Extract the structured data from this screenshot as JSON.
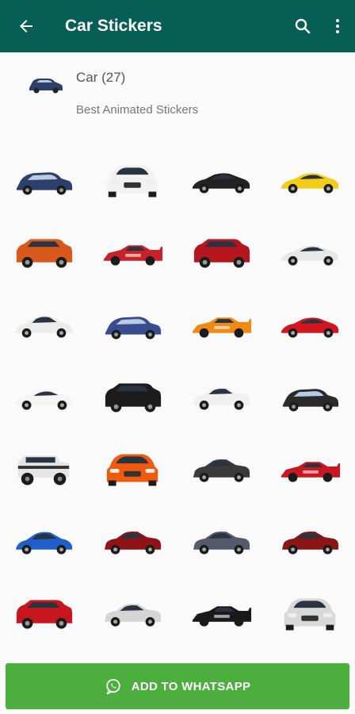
{
  "appbar": {
    "title": "Car Stickers",
    "color": "#075e54",
    "icons": [
      "back-arrow-icon",
      "search-icon",
      "more-vert-icon"
    ]
  },
  "pack": {
    "name": "Car (27)",
    "publisher": "Best Animated Stickers"
  },
  "stickers": [
    {
      "color": "#2d3f6b",
      "kind": "hatch"
    },
    {
      "color": "#f2f2f2",
      "kind": "front"
    },
    {
      "color": "#222222",
      "kind": "super"
    },
    {
      "color": "#f2cc17",
      "kind": "super"
    },
    {
      "color": "#d9581b",
      "kind": "suv"
    },
    {
      "color": "#c7222a",
      "kind": "racer"
    },
    {
      "color": "#b5151d",
      "kind": "suv"
    },
    {
      "color": "#e8e8e8",
      "kind": "super"
    },
    {
      "color": "#ececec",
      "kind": "coupe"
    },
    {
      "color": "#3a4c8f",
      "kind": "hatch"
    },
    {
      "color": "#f08a14",
      "kind": "racer"
    },
    {
      "color": "#d4141e",
      "kind": "super"
    },
    {
      "color": "#f5f5f5",
      "kind": "super"
    },
    {
      "color": "#1c1c1c",
      "kind": "suv"
    },
    {
      "color": "#f0f0f0",
      "kind": "sedan"
    },
    {
      "color": "#2a2a2a",
      "kind": "hatch"
    },
    {
      "color": "#e5e5e5",
      "kind": "jeep"
    },
    {
      "color": "#f05a0c",
      "kind": "front"
    },
    {
      "color": "#3a3a3a",
      "kind": "sedan"
    },
    {
      "color": "#c81720",
      "kind": "racer"
    },
    {
      "color": "#1f5fc7",
      "kind": "coupe"
    },
    {
      "color": "#8e1418",
      "kind": "sedan"
    },
    {
      "color": "#55596a",
      "kind": "sedan"
    },
    {
      "color": "#8a1517",
      "kind": "sedan"
    },
    {
      "color": "#c7171c",
      "kind": "suv"
    },
    {
      "color": "#d5d5d5",
      "kind": "sedan"
    },
    {
      "color": "#1a1a1a",
      "kind": "racer"
    },
    {
      "color": "#d8d8d8",
      "kind": "front"
    }
  ],
  "cta": {
    "label": "ADD TO WHATSAPP",
    "color": "#4caf3d",
    "icon": "whatsapp-icon"
  }
}
